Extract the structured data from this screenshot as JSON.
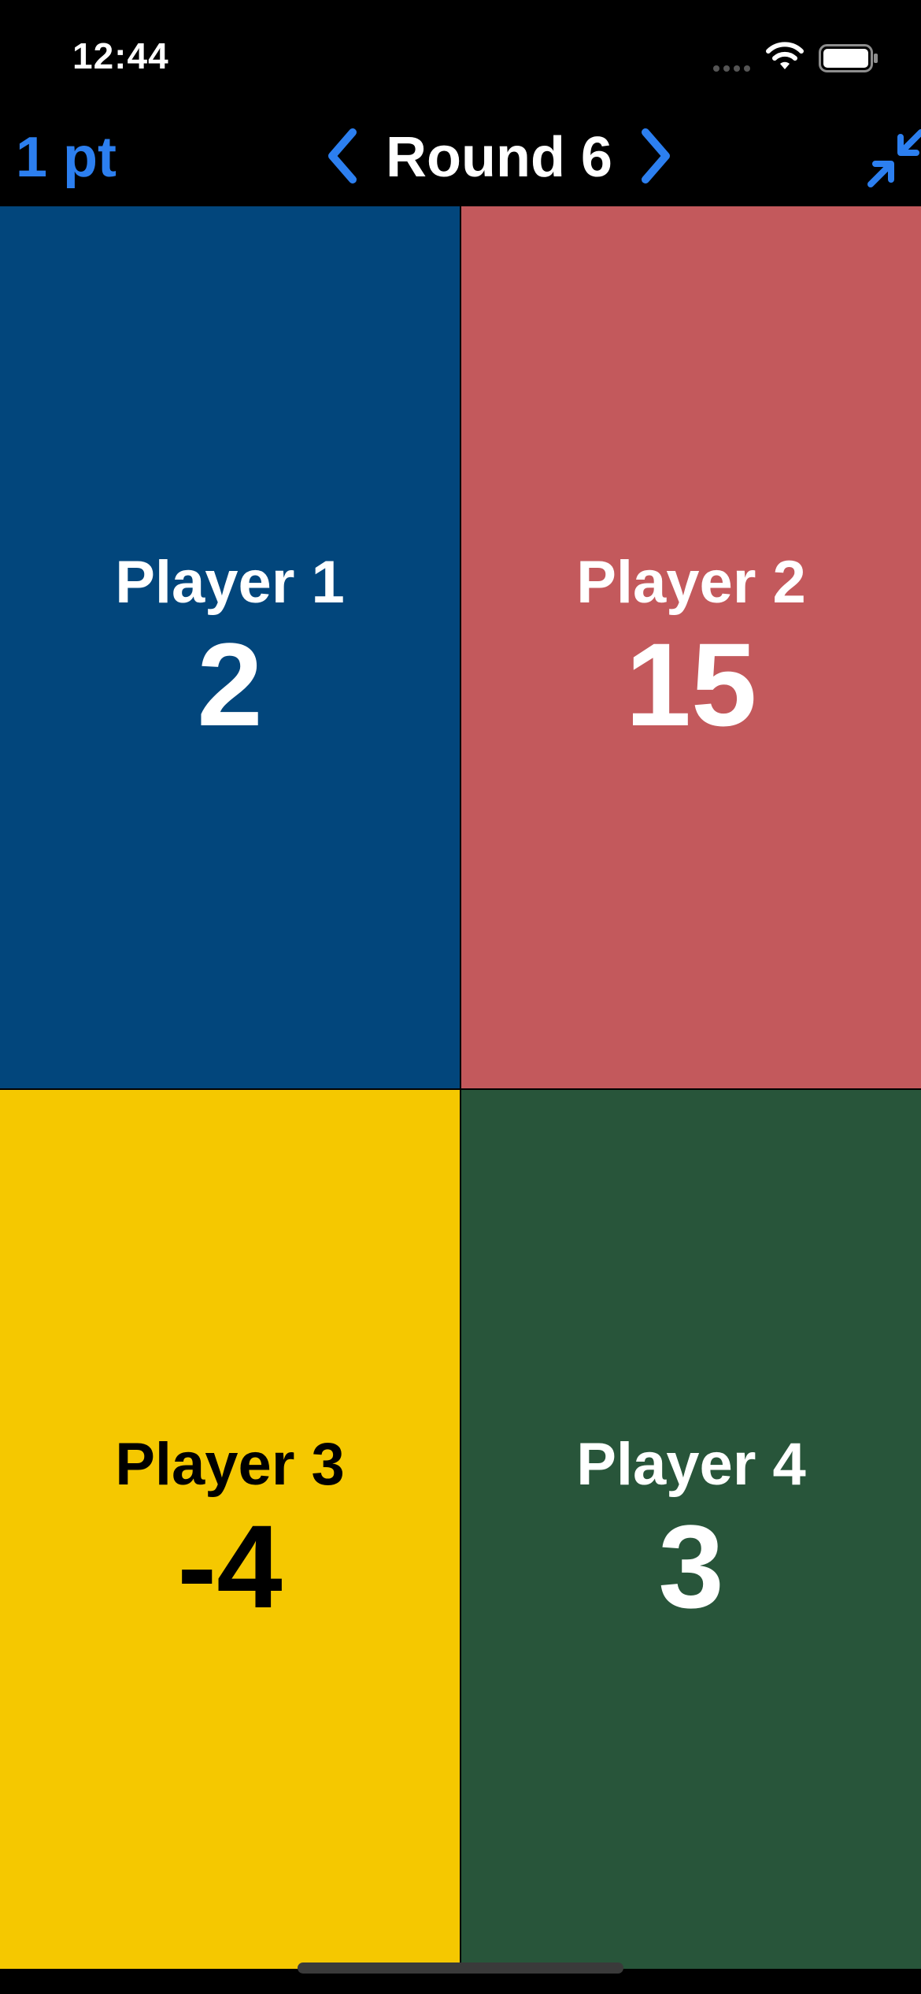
{
  "status_bar": {
    "time": "12:44"
  },
  "nav": {
    "points_label": "1 pt",
    "round_title": "Round 6",
    "accent_color": "#2c7ff0",
    "prev_icon": "chevron-left-icon",
    "next_icon": "chevron-right-icon",
    "collapse_icon": "collapse-arrows-icon"
  },
  "players": [
    {
      "name": "Player 1",
      "score": "2",
      "bg_color": "#02467c",
      "text_color": "#ffffff"
    },
    {
      "name": "Player 2",
      "score": "15",
      "bg_color": "#c3595c",
      "text_color": "#ffffff"
    },
    {
      "name": "Player 3",
      "score": "-4",
      "bg_color": "#f5c800",
      "text_color": "#000000"
    },
    {
      "name": "Player 4",
      "score": "3",
      "bg_color": "#28553a",
      "text_color": "#ffffff"
    }
  ]
}
